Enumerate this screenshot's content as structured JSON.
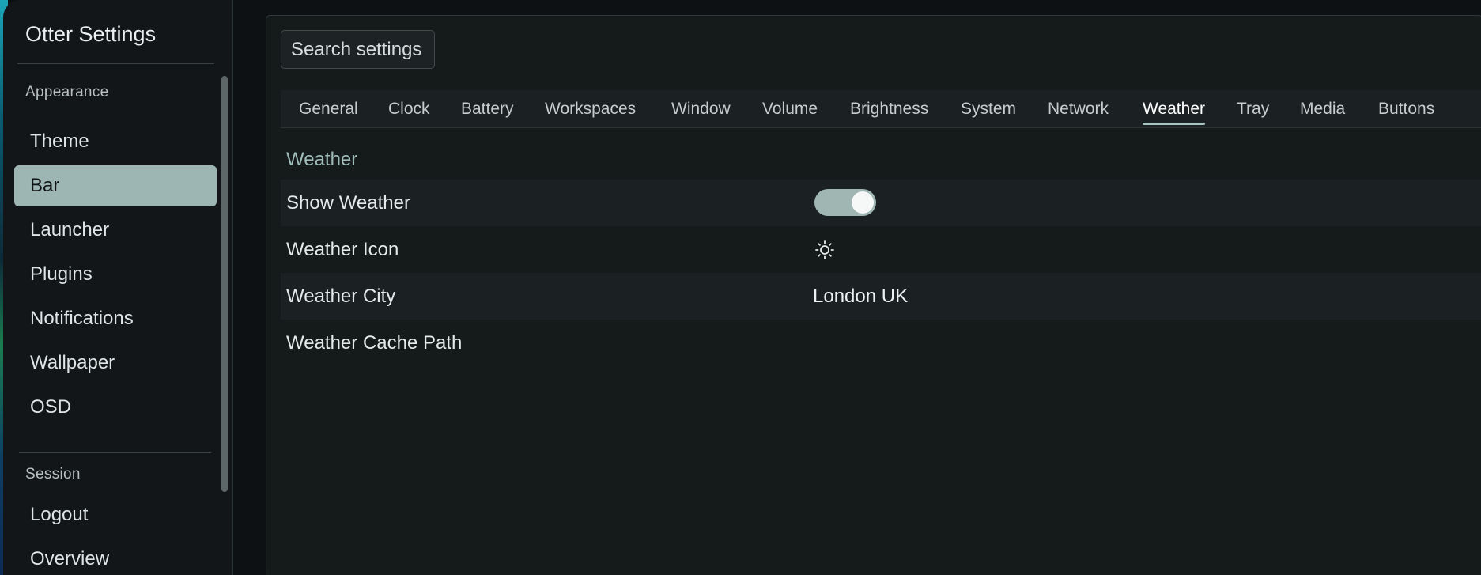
{
  "app": {
    "title": "Otter Settings"
  },
  "sidebar": {
    "groups": [
      {
        "label": "Appearance",
        "items": [
          {
            "label": "Theme",
            "active": false
          },
          {
            "label": "Bar",
            "active": true
          },
          {
            "label": "Launcher",
            "active": false
          },
          {
            "label": "Plugins",
            "active": false
          },
          {
            "label": "Notifications",
            "active": false
          },
          {
            "label": "Wallpaper",
            "active": false
          },
          {
            "label": "OSD",
            "active": false
          }
        ]
      },
      {
        "label": "Session",
        "items": [
          {
            "label": "Logout",
            "active": false
          },
          {
            "label": "Overview",
            "active": false
          }
        ]
      }
    ]
  },
  "search": {
    "placeholder": "Search settings",
    "value": ""
  },
  "tabs": [
    {
      "label": "General",
      "active": false
    },
    {
      "label": "Clock",
      "active": false
    },
    {
      "label": "Battery",
      "active": false
    },
    {
      "label": "Workspaces",
      "active": false
    },
    {
      "label": "Window",
      "active": false
    },
    {
      "label": "Volume",
      "active": false
    },
    {
      "label": "Brightness",
      "active": false
    },
    {
      "label": "System",
      "active": false
    },
    {
      "label": "Network",
      "active": false
    },
    {
      "label": "Weather",
      "active": true
    },
    {
      "label": "Tray",
      "active": false
    },
    {
      "label": "Media",
      "active": false
    },
    {
      "label": "Buttons",
      "active": false
    }
  ],
  "section": {
    "title": "Weather",
    "rows": [
      {
        "label": "Show Weather",
        "control": "toggle",
        "value": true
      },
      {
        "label": "Weather Icon",
        "control": "icon",
        "icon": "sun-icon"
      },
      {
        "label": "Weather City",
        "control": "text",
        "value": "London UK"
      },
      {
        "label": "Weather Cache Path",
        "control": "text",
        "value": ""
      }
    ]
  },
  "colors": {
    "accent": "#9db5b3",
    "section_title": "#9fbcb8",
    "background": "#151a1b"
  }
}
